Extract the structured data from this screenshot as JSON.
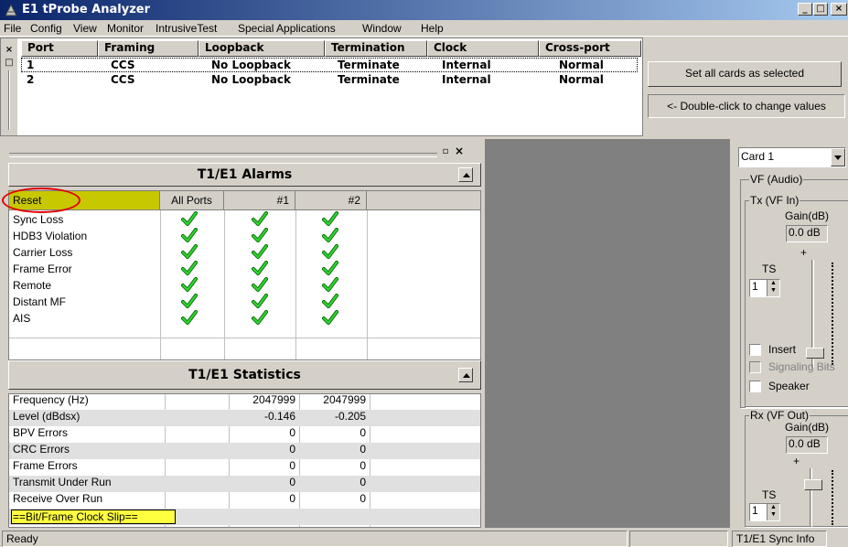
{
  "window": {
    "title": "E1 tProbe Analyzer",
    "min": "_",
    "max": "□",
    "close": "×"
  },
  "menu": [
    "File",
    "Config",
    "View",
    "Monitor",
    "IntrusiveTest",
    "Special Applications",
    "Window",
    "Help"
  ],
  "ports": {
    "headers": [
      "Port",
      "Framing",
      "Loopback",
      "Termination",
      "Clock",
      "Cross-port"
    ],
    "rows": [
      [
        "1",
        "CCS",
        "No Loopback",
        "Terminate",
        "Internal",
        "Normal"
      ],
      [
        "2",
        "CCS",
        "No Loopback",
        "Terminate",
        "Internal",
        "Normal"
      ]
    ],
    "set_all_label": "Set all cards as selected",
    "double_click_hint": "<- Double-click to change values"
  },
  "alarms": {
    "title": "T1/E1 Alarms",
    "reset_label": "Reset",
    "columns": [
      "All Ports",
      "#1",
      "#2"
    ],
    "rows": [
      "Sync Loss",
      "HDB3 Violation",
      "Carrier Loss",
      "Frame Error",
      "Remote",
      "Distant MF",
      "AIS"
    ],
    "status_icon": "green-check-icon",
    "highlight_color": "#c8c800",
    "annotation_color": "#e00000"
  },
  "statistics": {
    "title": "T1/E1 Statistics",
    "rows": [
      {
        "label": "Frequency (Hz)",
        "p1": "2047999",
        "p2": "2047999"
      },
      {
        "label": "Level (dBdsx)",
        "p1": "-0.146",
        "p2": "-0.205"
      },
      {
        "label": "BPV Errors",
        "p1": "0",
        "p2": "0"
      },
      {
        "label": "CRC Errors",
        "p1": "0",
        "p2": "0"
      },
      {
        "label": "Frame Errors",
        "p1": "0",
        "p2": "0"
      },
      {
        "label": "Transmit Under Run",
        "p1": "0",
        "p2": "0"
      },
      {
        "label": "Receive Over Run",
        "p1": "0",
        "p2": "0"
      }
    ],
    "clock_slip_label": "==Bit/Frame Clock Slip=="
  },
  "vf": {
    "card_select": "Card 1",
    "group_title": "VF (Audio)",
    "tx_title": "Tx (VF In)",
    "tx_gain_label": "Gain(dB)",
    "tx_gain_value": "0.0 dB",
    "plus": "+",
    "ts_label": "TS",
    "tx_ts_value": "1",
    "insert_label": "Insert",
    "signaling_bits_label": "Signaling Bits",
    "speaker_label": "Speaker",
    "rx_title": "Rx (VF Out)",
    "rx_gain_label": "Gain(dB)",
    "rx_gain_value": "0.0 dB",
    "rx_ts_value": "1"
  },
  "status": {
    "text": "Ready",
    "sync_info": "T1/E1 Sync Info"
  }
}
